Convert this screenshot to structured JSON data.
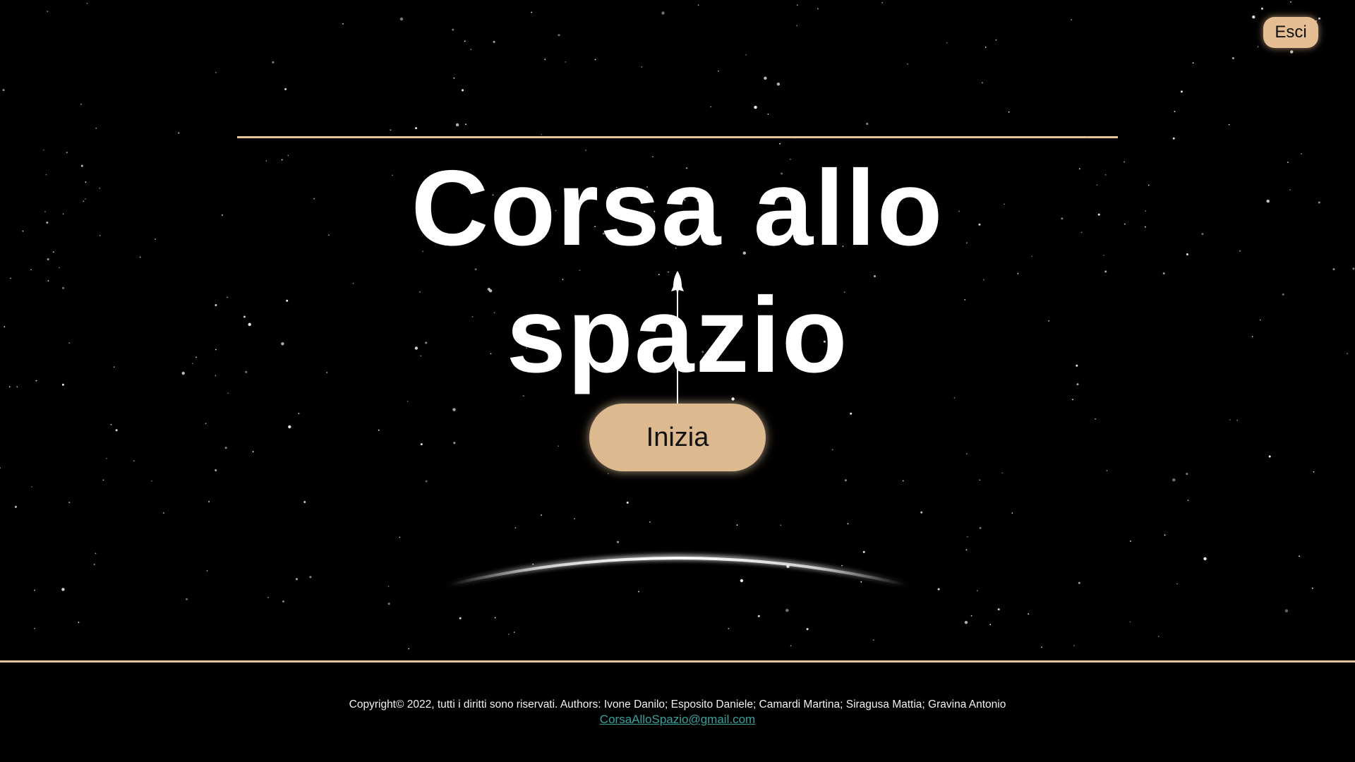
{
  "header": {
    "exit_label": "Esci"
  },
  "main": {
    "title": "Corsa allo spazio",
    "start_label": "Inizia"
  },
  "footer": {
    "copyright": "Copyright© 2022, tutti i diritti sono riservati. Authors: Ivone Danilo; Esposito Daniele; Camardi Martina; Siragusa Mattia; Gravina Antonio",
    "email": "CorsaAlloSpazio@gmail.com"
  },
  "icons": {
    "rocket": "rocket-icon",
    "horizon": "planet-horizon"
  },
  "colors": {
    "background": "#000000",
    "accent": "#e5be93",
    "rule": "#e7c39c",
    "link": "#3aa19a",
    "text": "#ffffff"
  }
}
